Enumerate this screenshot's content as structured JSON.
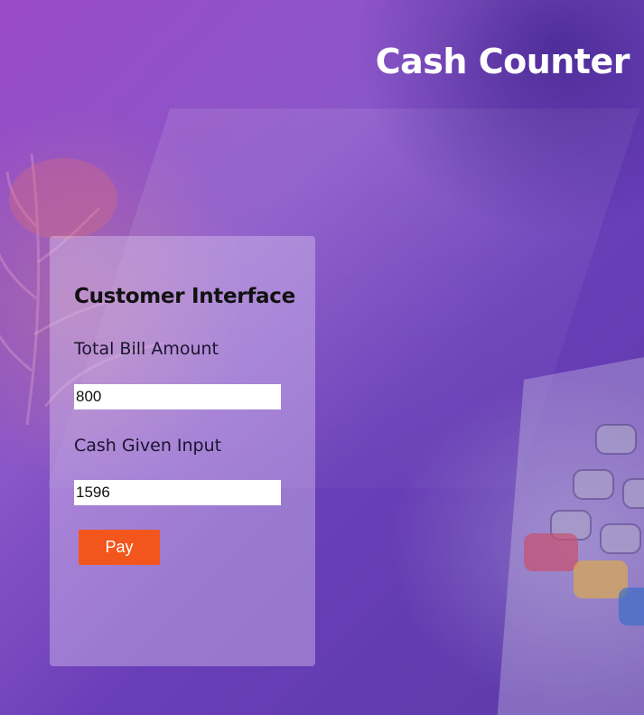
{
  "page": {
    "title": "Cash Counter"
  },
  "customer_interface": {
    "heading": "Customer Interface",
    "total_bill": {
      "label": "Total Bill Amount",
      "value": "800"
    },
    "cash_given": {
      "label": "Cash Given Input",
      "value": "1596"
    },
    "pay_button": "Pay"
  },
  "colors": {
    "background": "#8a56c8",
    "pay_button": "#f2561d",
    "title_text": "#ffffff"
  },
  "icons": {
    "background_left": "fern-plant",
    "background_right": "card-payment-terminal"
  }
}
